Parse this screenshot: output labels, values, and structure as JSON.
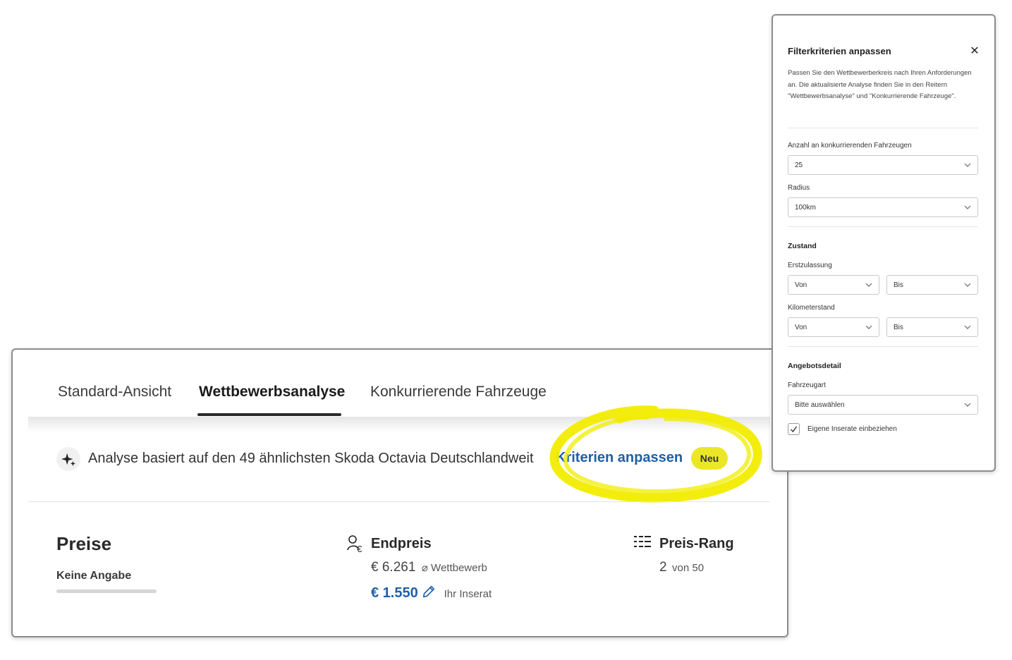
{
  "tabs": [
    {
      "label": "Standard-Ansicht"
    },
    {
      "label": "Wettbewerbsanalyse",
      "active": true
    },
    {
      "label": "Konkurrierende Fahrzeuge"
    }
  ],
  "analysis": {
    "icon": "sparkle-icon",
    "text": "Analyse basiert auf den 49 ähnlichsten Skoda Octavia Deutschlandweit",
    "link": "Kriterien anpassen",
    "badge": "Neu"
  },
  "prices": {
    "title": "Preise",
    "no_data": "Keine Angabe",
    "endpreis": {
      "title": "Endpreis",
      "competition_value": "€ 6.261",
      "competition_label": "⌀ Wettbewerb",
      "own_value": "€ 1.550",
      "own_label": "Ihr Inserat"
    },
    "rank": {
      "title": "Preis-Rang",
      "value": "2",
      "of": "von 50"
    }
  },
  "filter_panel": {
    "title": "Filterkriterien anpassen",
    "description": "Passen Sie den Wettbewerberkreis nach Ihren Anforderungen an. Die aktualisierte Analyse finden Sie in den Reitern \"Wettbewerbsanalyse\" und \"Konkurrierende Fahrzeuge\".",
    "count_label": "Anzahl an konkurrierenden Fahrzeugen",
    "count_value": "25",
    "radius_label": "Radius",
    "radius_value": "100km",
    "condition_title": "Zustand",
    "registration_label": "Erstzulassung",
    "registration_from": "Von",
    "registration_to": "Bis",
    "mileage_label": "Kilometerstand",
    "mileage_from": "Von",
    "mileage_to": "Bis",
    "offer_title": "Angebotsdetail",
    "vehicle_type_label": "Fahrzeugart",
    "vehicle_type_placeholder": "Bitte auswählen",
    "own_listings_label": "Eigene Inserate einbeziehen",
    "own_listings_checked": true
  },
  "colors": {
    "link": "#1f5fa6",
    "highlight": "#f2ec00",
    "badge": "#ece726"
  }
}
